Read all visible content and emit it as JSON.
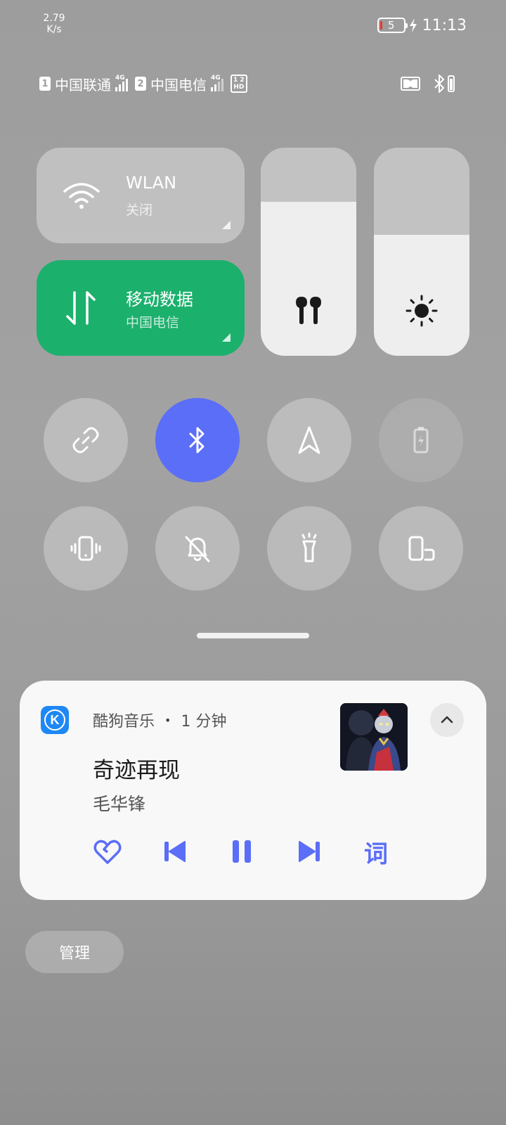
{
  "status_bar": {
    "net_speed_value": "2.79",
    "net_speed_unit": "K/s",
    "battery_level": "5",
    "time": "11:13",
    "charging_icon": "bolt-icon"
  },
  "carriers": [
    {
      "sim": "1",
      "name": "中国联通",
      "network": "4G"
    },
    {
      "sim": "2",
      "name": "中国电信",
      "network": "4G"
    }
  ],
  "hd_badge": {
    "line1": "1 2",
    "line2": "HD"
  },
  "tiles": {
    "wlan": {
      "title": "WLAN",
      "status": "关闭",
      "icon": "wifi-icon"
    },
    "mobile_data": {
      "title": "移动数据",
      "status": "中国电信",
      "icon": "data-arrows-icon",
      "color": "#1cb06d"
    }
  },
  "sliders": {
    "volume": {
      "level": 0.74,
      "icon": "earbuds-icon"
    },
    "brightness": {
      "level": 0.58,
      "icon": "sun-icon"
    }
  },
  "toggles": [
    {
      "name": "link",
      "icon": "link-icon",
      "active": false
    },
    {
      "name": "bluetooth",
      "icon": "bluetooth-icon",
      "active": true
    },
    {
      "name": "location",
      "icon": "location-arrow-icon",
      "active": false
    },
    {
      "name": "battery-saver",
      "icon": "battery-saver-icon",
      "active": false,
      "disabled": true
    },
    {
      "name": "vibrate",
      "icon": "vibrate-icon",
      "active": false
    },
    {
      "name": "mute",
      "icon": "bell-off-icon",
      "active": false
    },
    {
      "name": "flashlight",
      "icon": "flashlight-icon",
      "active": false
    },
    {
      "name": "auto-rotate",
      "icon": "rotate-icon",
      "active": false
    }
  ],
  "media": {
    "app_name": "酷狗音乐",
    "separator": "•",
    "time_ago": "1 分钟",
    "song_title": "奇迹再现",
    "artist": "毛华锋",
    "lyrics_label": "词",
    "accent": "#5b6ef7"
  },
  "manage_label": "管理"
}
